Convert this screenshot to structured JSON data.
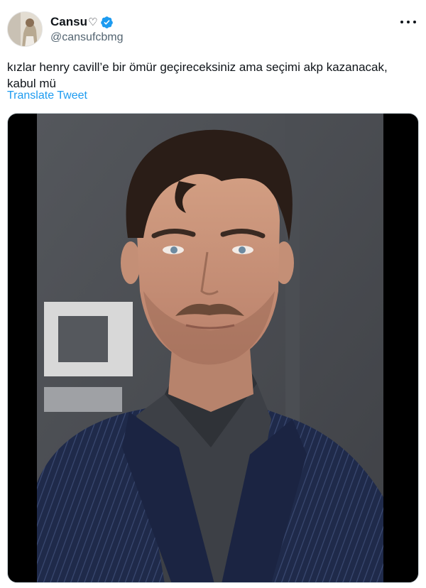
{
  "user": {
    "display_name": "Cansu",
    "heart_glyph": "♡",
    "handle": "@cansufcbmg",
    "verified": true,
    "avatar_icon": "profile-avatar",
    "verified_icon": "verified-badge-icon"
  },
  "menu": {
    "icon": "more-options-icon"
  },
  "tweet": {
    "text": "kızlar henry cavill’e bir ömür geçireceksiniz ama seçimi akp kazanacak, kabul mü",
    "translate_label": "Translate Tweet"
  },
  "media": {
    "type": "photo"
  },
  "colors": {
    "link": "#1d9bf0",
    "text": "#0f1419",
    "secondary": "#536471",
    "verified": "#1d9bf0",
    "letterbox": "#000000"
  }
}
